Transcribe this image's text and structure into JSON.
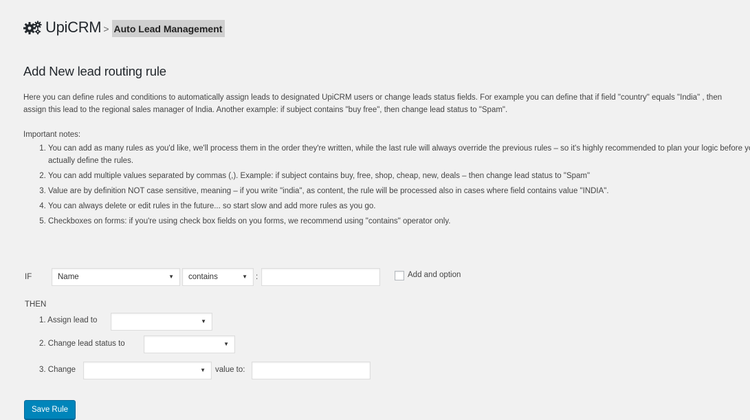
{
  "header": {
    "icon": "gears-icon",
    "brand": "UpiCRM",
    "separator": ">",
    "breadcrumb": "Auto Lead Management"
  },
  "page": {
    "title": "Add New lead routing rule",
    "intro": "Here you can define rules and conditions to automatically assign leads to designated UpiCRM users or change leads status fields. For example you can define that if field \"country\" equals \"India\" , then assign this lead to the regional sales manager of India. Another example: if subject contains \"buy free\", then change lead status to \"Spam\".",
    "notes_title": "Important notes:",
    "notes": [
      "You can add as many rules as you'd like, we'll process them in the order they're written, while the last rule will always override the previous rules – so it's highly recommended to plan your logic before you actually define the rules.",
      "You can add multiple values separated by commas (,). Example: if subject contains buy, free, shop, cheap, new, deals – then change lead status to \"Spam\"",
      "Value are by definition NOT case sensitive, meaning – if you write \"india\", as content, the rule will be processed also in cases where field contains value \"INDIA\".",
      "You can always delete or edit rules in the future... so start slow and add more rules as you go.",
      "Checkboxes on forms: if you're using check box fields on you forms, we recommend using \"contains\" operator only."
    ]
  },
  "rule_form": {
    "if_label": "IF",
    "field_select": "Name",
    "operator_select": "contains",
    "colon": ":",
    "value_input": "",
    "add_option_label": "Add and option",
    "add_option_checked": false,
    "then_label": "THEN",
    "assign_label": "1. Assign lead to",
    "assign_select": "",
    "status_label": "2. Change lead status to",
    "status_select": "",
    "change_label": "3. Change",
    "change_field_select": "",
    "value_to_label": "value to:",
    "value_to_input": "",
    "caret": "▼"
  },
  "save_button": "Save Rule",
  "colors": {
    "background": "#f1f1f1",
    "button": "#0085ba",
    "breadcrumb_bg": "#cfcfcf"
  }
}
